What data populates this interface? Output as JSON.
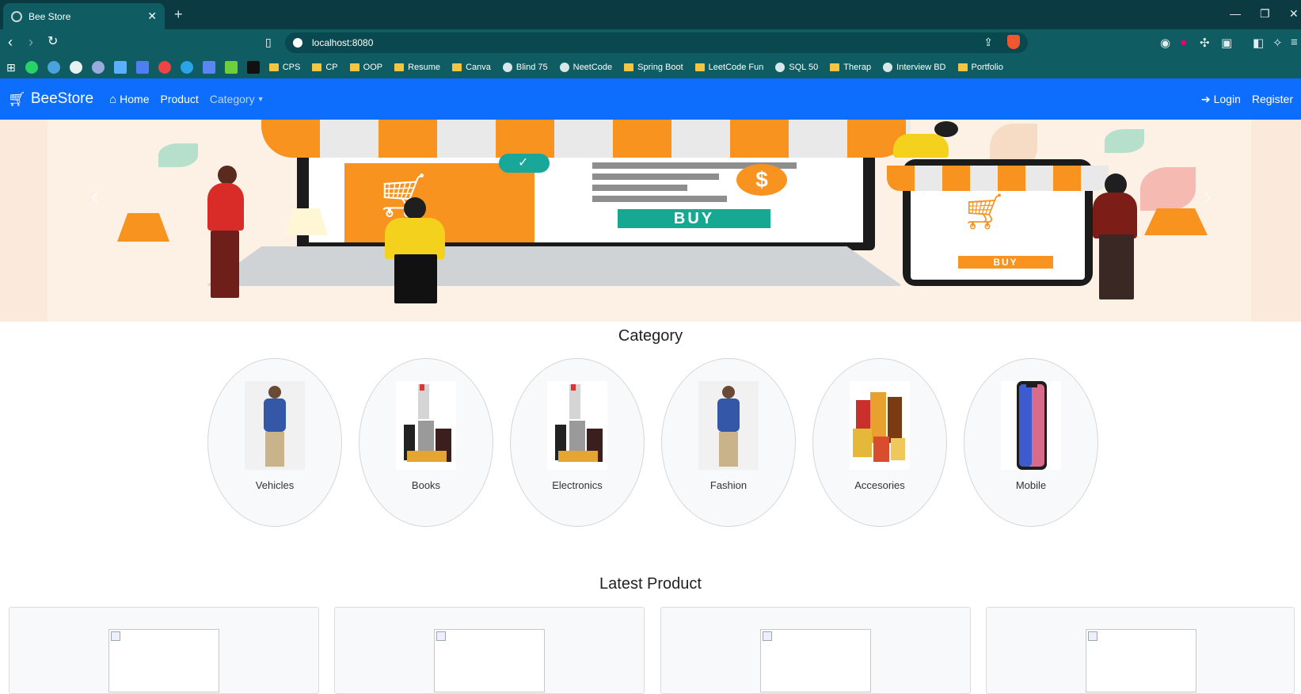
{
  "browser": {
    "tab_title": "Bee Store",
    "url": "localhost:8080",
    "bookmarks": [
      "CPS",
      "CP",
      "OOP",
      "Resume",
      "Canva",
      "Blind 75",
      "NeetCode",
      "Spring Boot",
      "LeetCode Fun",
      "SQL 50",
      "Therap",
      "Interview BD",
      "Portfolio"
    ]
  },
  "navbar": {
    "brand": "BeeStore",
    "home": "Home",
    "product": "Product",
    "category": "Category",
    "login": "Login",
    "register": "Register"
  },
  "banner": {
    "buy_label": "BUY",
    "phone_buy_label": "BUY",
    "dollar_symbol": "$"
  },
  "category_section": {
    "title": "Category",
    "items": [
      {
        "label": "Vehicles"
      },
      {
        "label": "Books"
      },
      {
        "label": "Electronics"
      },
      {
        "label": "Fashion"
      },
      {
        "label": "Accesories"
      },
      {
        "label": "Mobile"
      }
    ]
  },
  "latest_section": {
    "title": "Latest Product"
  },
  "colors": {
    "navbar": "#0d6efd",
    "chrome": "#0f5c63",
    "accent_orange": "#f7931e",
    "accent_teal": "#17a891"
  }
}
